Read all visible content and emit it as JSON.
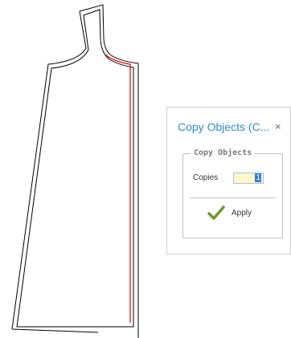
{
  "panel": {
    "title": "Copy Objects (C...",
    "close_symbol": "×",
    "group_title": "Copy Objects",
    "copies_label": "Copies",
    "copies_value": "1",
    "apply_label": "Apply",
    "title_color": "#2e8ec9"
  },
  "icons": {
    "apply": "checkmark-icon",
    "close": "close-icon"
  },
  "colors": {
    "outline": "#000000",
    "selected_edge": "#e00000",
    "apply_check": "#6c9a2e"
  }
}
